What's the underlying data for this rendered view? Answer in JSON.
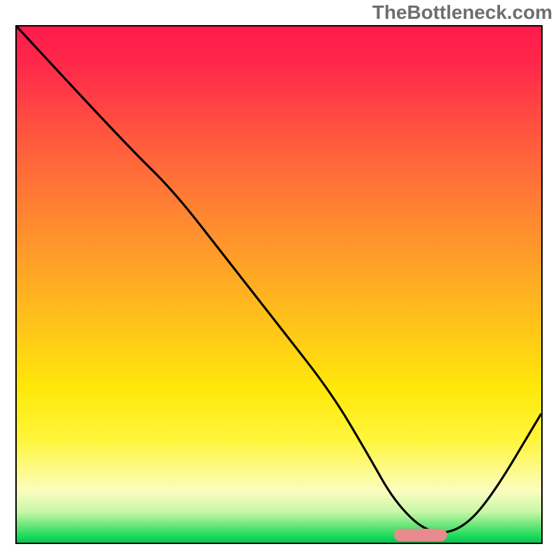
{
  "watermark": "TheBottleneck.com",
  "chart_data": {
    "type": "line",
    "title": "",
    "xlabel": "",
    "ylabel": "",
    "xlim": [
      0,
      100
    ],
    "ylim": [
      0,
      100
    ],
    "grid": false,
    "series": [
      {
        "name": "curve",
        "x": [
          0,
          10,
          22,
          30,
          40,
          50,
          60,
          67,
          72,
          78,
          84,
          90,
          100
        ],
        "values": [
          100,
          89,
          76,
          68,
          55,
          42,
          29,
          17,
          8,
          2,
          2,
          8,
          25
        ]
      }
    ],
    "marker": {
      "x_start": 72,
      "x_end": 82,
      "y": 1.5
    },
    "gradient_stops": [
      {
        "pos": 0,
        "color": "#ff1a4c"
      },
      {
        "pos": 8,
        "color": "#ff2a4a"
      },
      {
        "pos": 22,
        "color": "#ff5a3e"
      },
      {
        "pos": 38,
        "color": "#ff8a30"
      },
      {
        "pos": 54,
        "color": "#ffb91e"
      },
      {
        "pos": 70,
        "color": "#ffe80a"
      },
      {
        "pos": 80,
        "color": "#fff53a"
      },
      {
        "pos": 90,
        "color": "#fbfdc0"
      },
      {
        "pos": 94,
        "color": "#c8f7a8"
      },
      {
        "pos": 97,
        "color": "#5ee472"
      },
      {
        "pos": 99,
        "color": "#12d85a"
      },
      {
        "pos": 100,
        "color": "#0fc14e"
      }
    ]
  }
}
